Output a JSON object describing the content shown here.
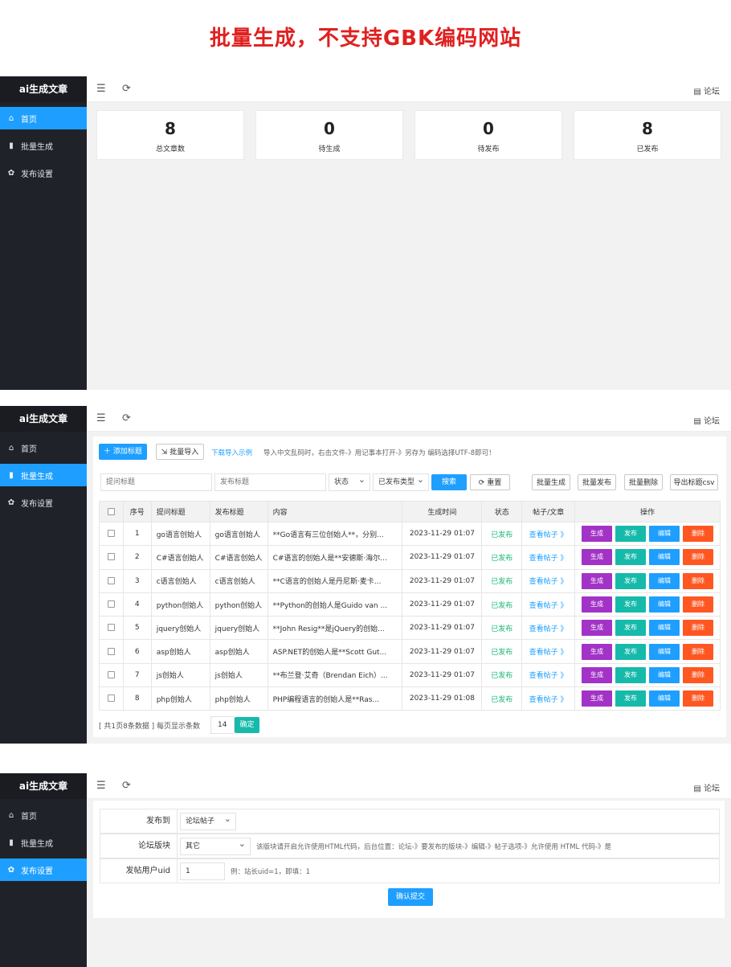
{
  "banner_title": "批量生成，不支持GBK编码网站",
  "app_title": "ai生成文章",
  "nav": [
    {
      "label": "首页",
      "icon": "home-icon"
    },
    {
      "label": "批量生成",
      "icon": "columns-icon"
    },
    {
      "label": "发布设置",
      "icon": "gear-icon"
    }
  ],
  "topbar": {
    "forum_label": "论坛"
  },
  "dashboard": {
    "stats": [
      {
        "value": "8",
        "label": "总文章数"
      },
      {
        "value": "0",
        "label": "待生成"
      },
      {
        "value": "0",
        "label": "待发布"
      },
      {
        "value": "8",
        "label": "已发布"
      }
    ]
  },
  "batch": {
    "add_button": "添加标题",
    "import_button": "批量导入",
    "download_link": "下载导入示例",
    "import_tip": "导入中文乱码时，右击文件-》用记事本打开-》另存为 编码选择UTF-8即可！",
    "question_placeholder": "提问标题",
    "post_placeholder": "发布标题",
    "status_select": "状态",
    "type_select": "已发布类型",
    "search_button": "搜索",
    "reset_button": "重置",
    "bulk_generate": "批量生成",
    "bulk_publish": "批量发布",
    "bulk_delete": "批量删除",
    "export_csv": "导出标题csv",
    "headers": [
      "序号",
      "提问标题",
      "发布标题",
      "内容",
      "生成时间",
      "状态",
      "帖子/文章",
      "操作"
    ],
    "rows": [
      {
        "no": "1",
        "q": "go语言创始人",
        "p": "go语言创始人",
        "content": "**Go语言有三位创始人**，分别...",
        "time": "2023-11-29 01:07",
        "status": "已发布",
        "link": "查看帖子 》"
      },
      {
        "no": "2",
        "q": "C#语言创始人",
        "p": "C#语言创始人",
        "content": "C#语言的创始人是**安德斯·海尔...",
        "time": "2023-11-29 01:07",
        "status": "已发布",
        "link": "查看帖子 》"
      },
      {
        "no": "3",
        "q": "c语言创始人",
        "p": "c语言创始人",
        "content": "**C语言的创始人是丹尼斯·麦卡...",
        "time": "2023-11-29 01:07",
        "status": "已发布",
        "link": "查看帖子 》"
      },
      {
        "no": "4",
        "q": "python创始人",
        "p": "python创始人",
        "content": "**Python的创始人是Guido van ...",
        "time": "2023-11-29 01:07",
        "status": "已发布",
        "link": "查看帖子 》"
      },
      {
        "no": "5",
        "q": "jquery创始人",
        "p": "jquery创始人",
        "content": "**John Resig**是jQuery的创始...",
        "time": "2023-11-29 01:07",
        "status": "已发布",
        "link": "查看帖子 》"
      },
      {
        "no": "6",
        "q": "asp创始人",
        "p": "asp创始人",
        "content": "ASP.NET的创始人是**Scott Gut...",
        "time": "2023-11-29 01:07",
        "status": "已发布",
        "link": "查看帖子 》"
      },
      {
        "no": "7",
        "q": "js创始人",
        "p": "js创始人",
        "content": "**布兰登·艾奇（Brendan Eich）...",
        "time": "2023-11-29 01:07",
        "status": "已发布",
        "link": "查看帖子 》"
      },
      {
        "no": "8",
        "q": "php创始人",
        "p": "php创始人",
        "content": "PHP编程语言的创始人是**Ras...",
        "time": "2023-11-29 01:08",
        "status": "已发布",
        "link": "查看帖子 》"
      }
    ],
    "actions": {
      "generate": "生成",
      "publish": "发布",
      "edit": "编辑",
      "delete": "删除"
    },
    "pager_text": "[ 共1页8条数据 ]  每页显示条数",
    "page_size": "14",
    "confirm": "确定"
  },
  "settings": {
    "publish_to_label": "发布到",
    "publish_to_value": "论坛帖子",
    "board_label": "论坛版块",
    "board_value": "其它",
    "board_tip": "该版块请开启允许使用HTML代码，后台位置：论坛-》要发布的版块-》编辑-》帖子选项-》允许使用 HTML 代码-》是",
    "uid_label": "发帖用户uid",
    "uid_value": "1",
    "uid_tip": "例：站长uid=1，即填：1",
    "submit": "确认提交"
  }
}
